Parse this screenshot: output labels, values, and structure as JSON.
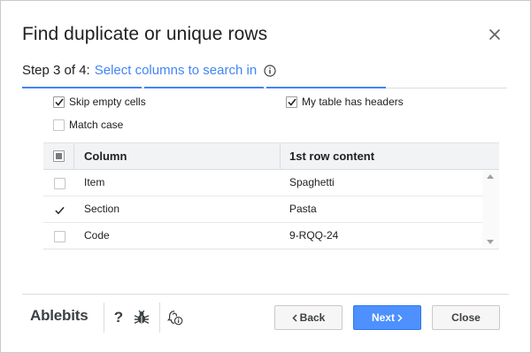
{
  "dialog": {
    "title": "Find duplicate or unique rows",
    "close_icon": "close-icon"
  },
  "step": {
    "label": "Step 3 of 4:",
    "link": "Select columns to search in",
    "info_icon": "info-icon",
    "total_steps": 4,
    "current_step": 3
  },
  "options": {
    "skip_empty": {
      "label": "Skip empty cells",
      "checked": true
    },
    "match_case": {
      "label": "Match case",
      "checked": false
    },
    "has_headers": {
      "label": "My table has headers",
      "checked": true
    }
  },
  "table": {
    "headers": {
      "select_all_state": "indeterminate",
      "column": "Column",
      "first_row": "1st row content"
    },
    "rows": [
      {
        "checked": false,
        "column": "Item",
        "content": "Spaghetti"
      },
      {
        "checked": true,
        "column": "Section",
        "content": "Pasta"
      },
      {
        "checked": false,
        "column": "Code",
        "content": "9-RQQ-24"
      }
    ]
  },
  "footer": {
    "brand": "Ablebits",
    "icons": [
      "help-icon",
      "bug-report-icon",
      "privacy-info-icon"
    ],
    "help_glyph": "?",
    "back_label": "Back",
    "next_label": "Next",
    "close_label": "Close"
  },
  "colors": {
    "accent": "#4285f4",
    "primary_button": "#4d90fe",
    "header_bg": "#f1f3f4"
  }
}
